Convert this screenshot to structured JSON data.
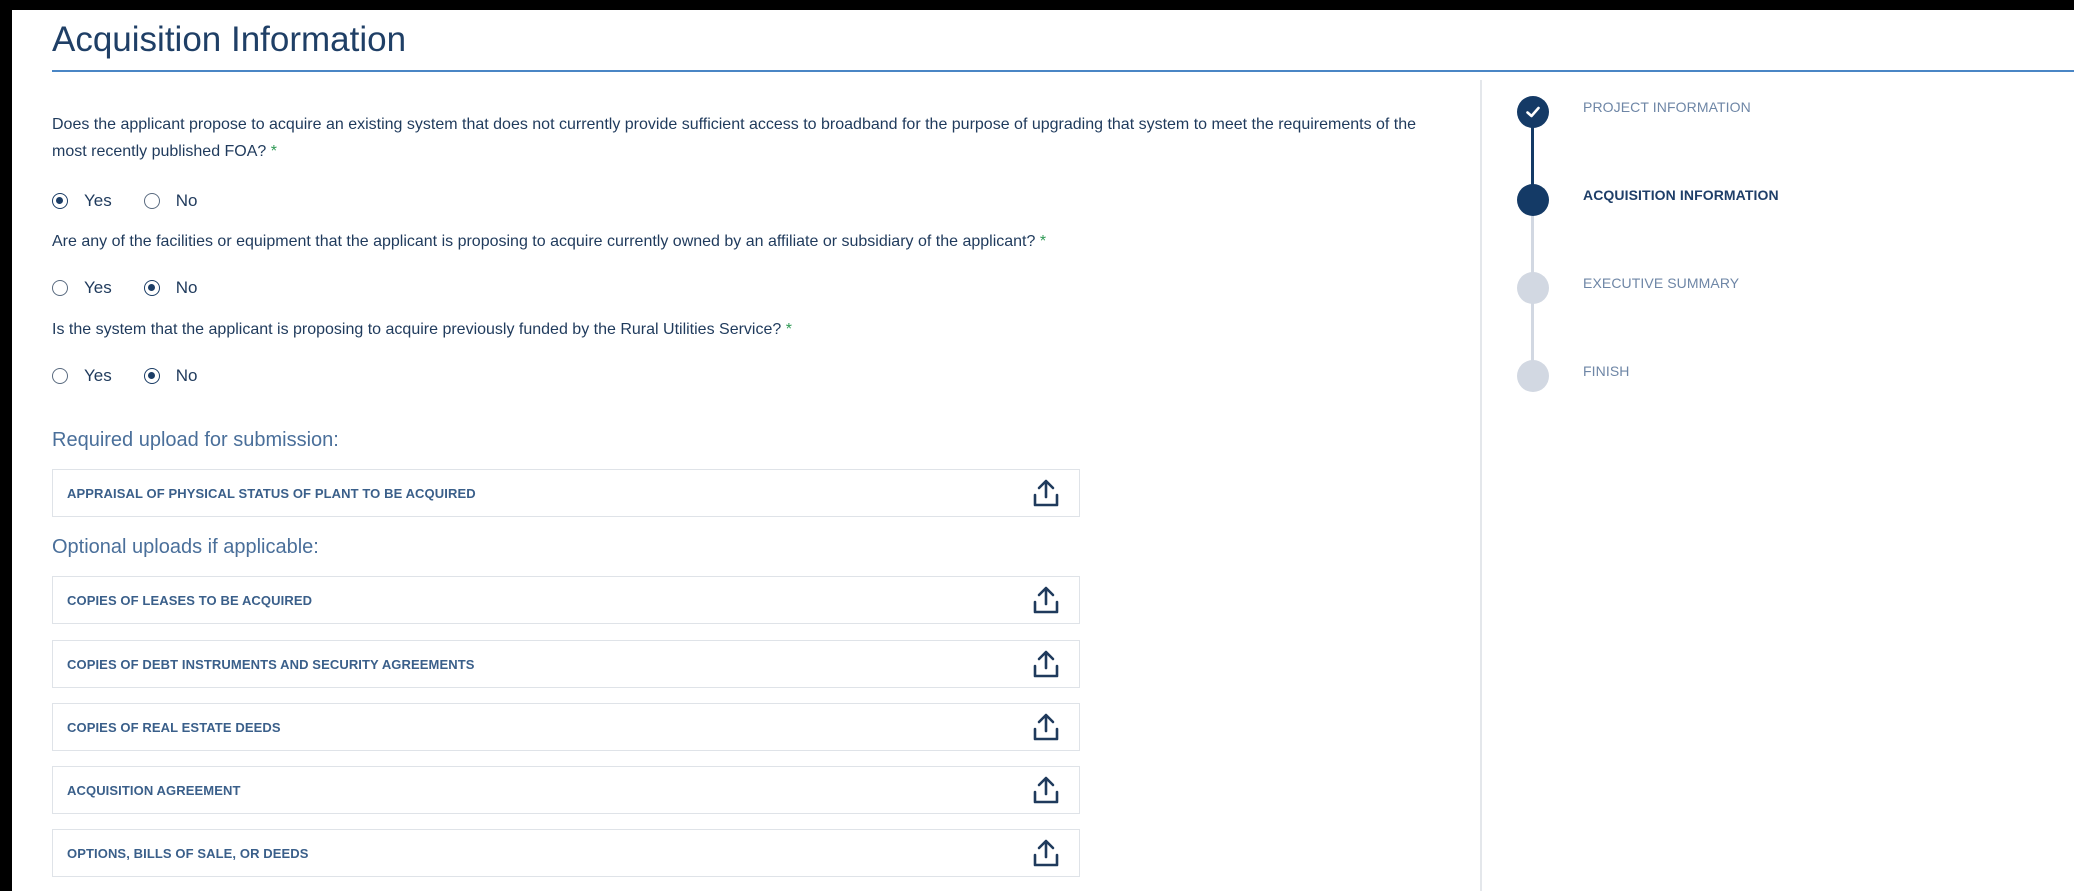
{
  "page": {
    "title": "Acquisition Information"
  },
  "questions": [
    {
      "text": "Does the applicant propose to acquire an existing system that does not currently provide sufficient access to broadband for the purpose of upgrading that system to meet the requirements of the most recently published FOA?",
      "required_mark": "*",
      "options": [
        "Yes",
        "No"
      ],
      "selected": "Yes"
    },
    {
      "text": "Are any of the facilities or equipment that the applicant is proposing to acquire currently owned by an affiliate or subsidiary of the applicant?",
      "required_mark": "*",
      "options": [
        "Yes",
        "No"
      ],
      "selected": "No"
    },
    {
      "text": "Is the system that the applicant is proposing to acquire previously funded by the Rural Utilities Service?",
      "required_mark": "*",
      "options": [
        "Yes",
        "No"
      ],
      "selected": "No"
    }
  ],
  "uploads": {
    "required_heading": "Required upload for submission:",
    "required": [
      "APPRAISAL OF PHYSICAL STATUS OF PLANT TO BE ACQUIRED"
    ],
    "optional_heading": "Optional uploads if applicable:",
    "optional": [
      "COPIES OF LEASES TO BE ACQUIRED",
      "COPIES OF DEBT INSTRUMENTS AND SECURITY AGREEMENTS",
      "COPIES OF REAL ESTATE DEEDS",
      "ACQUISITION AGREEMENT",
      "OPTIONS, BILLS OF SALE, OR DEEDS"
    ],
    "icon": "upload-icon"
  },
  "stepper": {
    "steps": [
      {
        "label": "PROJECT INFORMATION",
        "status": "done",
        "icon": "check-icon"
      },
      {
        "label": "ACQUISITION INFORMATION",
        "status": "active"
      },
      {
        "label": "EXECUTIVE SUMMARY",
        "status": "todo"
      },
      {
        "label": "FINISH",
        "status": "todo"
      }
    ]
  },
  "colors": {
    "primary": "#143a66",
    "title_rule": "#4a86c5",
    "required_star": "#2f9a55",
    "step_inactive": "#d2d8e2"
  }
}
